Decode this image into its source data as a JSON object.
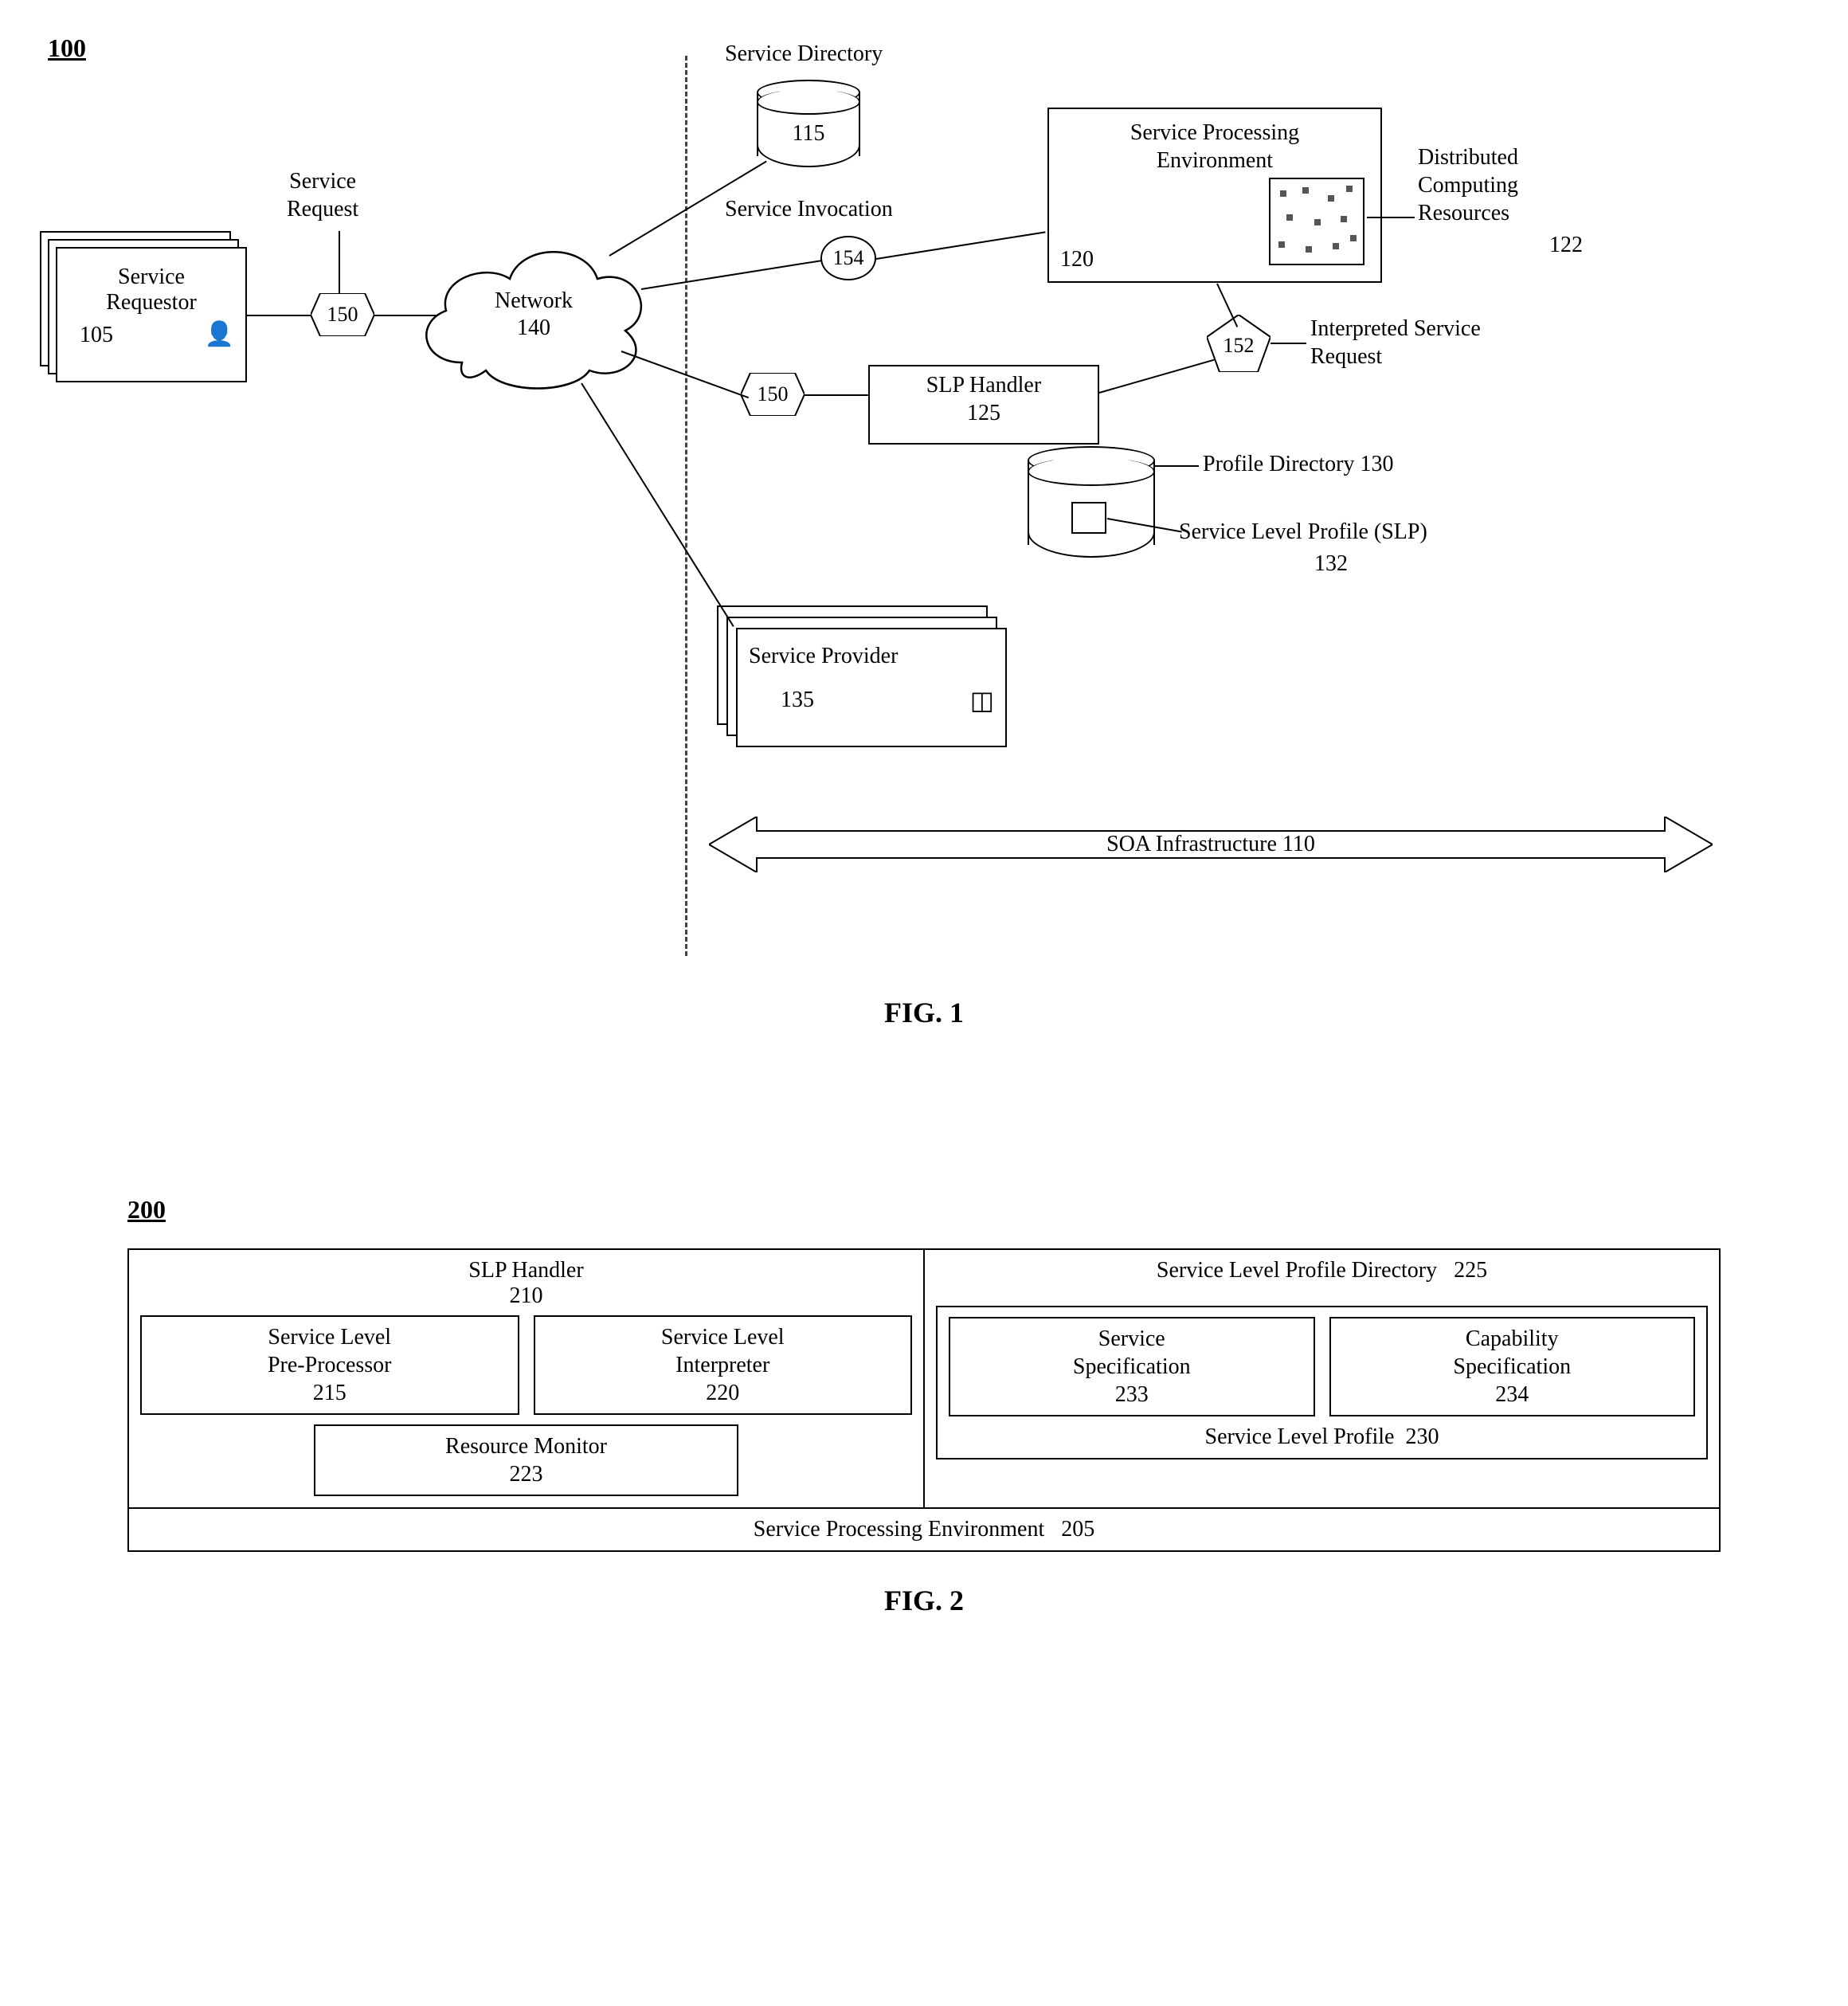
{
  "fig1": {
    "fignum": "100",
    "caption": "FIG. 1",
    "service_requestor": {
      "name": "Service\nRequestor",
      "num": "105"
    },
    "service_request_label": "Service\nRequest",
    "network": {
      "name": "Network",
      "num": "140"
    },
    "hex150a": "150",
    "hex150b": "150",
    "service_directory": {
      "label": "Service Directory",
      "num": "115"
    },
    "service_invocation_label": "Service Invocation",
    "circ154": "154",
    "spe": {
      "name": "Service Processing\nEnvironment",
      "num": "120"
    },
    "dcr": {
      "label": "Distributed\nComputing\nResources",
      "num": "122"
    },
    "pent152": "152",
    "isr_label": "Interpreted Service\nRequest",
    "slp_handler": {
      "name": "SLP Handler",
      "num": "125"
    },
    "profile_dir": {
      "label": "Profile Directory",
      "num": "130"
    },
    "slp": {
      "label": "Service Level Profile (SLP)",
      "num": "132"
    },
    "service_provider": {
      "name": "Service Provider",
      "num": "135"
    },
    "soa": {
      "label": "SOA Infrastructure",
      "num": "110"
    }
  },
  "fig2": {
    "fignum": "200",
    "caption": "FIG. 2",
    "slp_handler": {
      "name": "SLP Handler",
      "num": "210"
    },
    "slpp": {
      "name": "Service Level\nPre-Processor",
      "num": "215"
    },
    "sli": {
      "name": "Service Level\nInterpreter",
      "num": "220"
    },
    "rm": {
      "name": "Resource Monitor",
      "num": "223"
    },
    "slpd": {
      "name": "Service Level Profile Directory",
      "num": "225"
    },
    "sspec": {
      "name": "Service\nSpecification",
      "num": "233"
    },
    "cspec": {
      "name": "Capability\nSpecification",
      "num": "234"
    },
    "slp": {
      "name": "Service Level Profile",
      "num": "230"
    },
    "spe": {
      "name": "Service Processing Environment",
      "num": "205"
    }
  }
}
